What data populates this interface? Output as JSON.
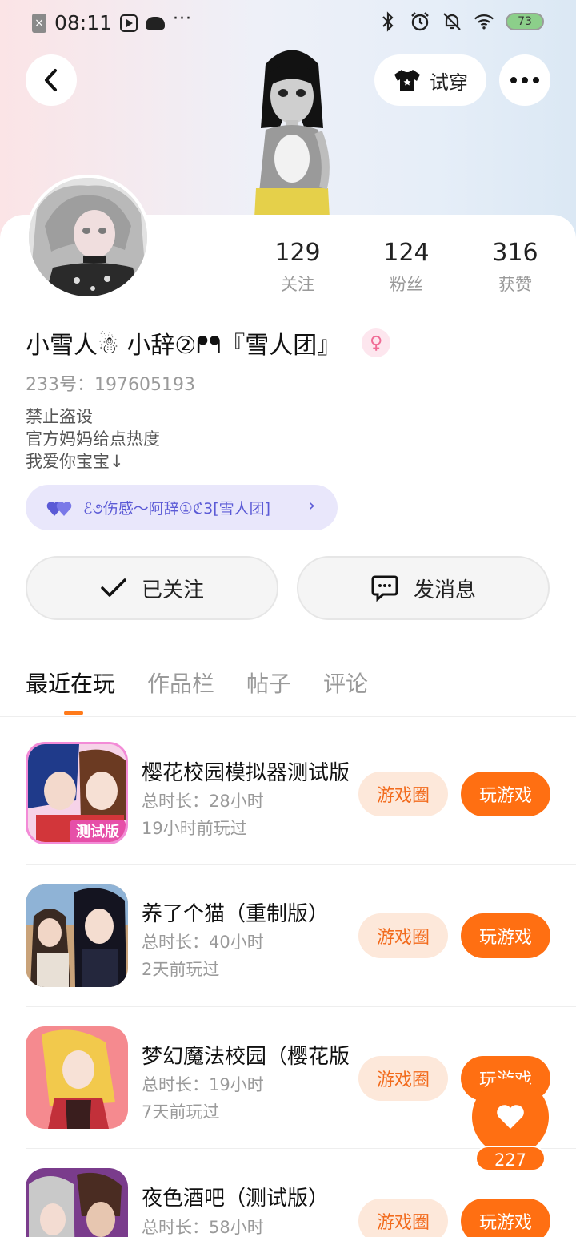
{
  "status_bar": {
    "time": "08:11",
    "battery": "73"
  },
  "header": {
    "tryon_label": "试穿"
  },
  "profile": {
    "nickname": "小雪人☃ 小辞②ᖰᖳ『雪人团』",
    "uid_text": "233号：197605193",
    "bio": [
      "禁止盗设",
      "官方妈妈给点热度",
      "我爱你宝宝↓"
    ],
    "group_chip": "ℰ૭伤感～阿辞①ℭ3[雪人团]",
    "stats": [
      {
        "value": "129",
        "label": "关注"
      },
      {
        "value": "124",
        "label": "粉丝"
      },
      {
        "value": "316",
        "label": "获赞"
      }
    ]
  },
  "actions": {
    "followed_label": "已关注",
    "message_label": "发消息"
  },
  "tabs": [
    "最近在玩",
    "作品栏",
    "帖子",
    "评论"
  ],
  "games": [
    {
      "title": "樱花校园模拟器测试版",
      "duration": "总时长：28小时",
      "last_played": "19小时前玩过",
      "circle_label": "游戏圈",
      "play_label": "玩游戏",
      "icon_caption": "测试版"
    },
    {
      "title": "养了个猫（重制版）",
      "duration": "总时长：40小时",
      "last_played": "2天前玩过",
      "circle_label": "游戏圈",
      "play_label": "玩游戏"
    },
    {
      "title": "梦幻魔法校园（樱花版）",
      "duration": "总时长：19小时",
      "last_played": "7天前玩过",
      "circle_label": "游戏圈",
      "play_label": "玩游戏"
    },
    {
      "title": "夜色酒吧（测试版）",
      "duration": "总时长：58小时",
      "last_played": "",
      "circle_label": "游戏圈",
      "play_label": "玩游戏"
    }
  ],
  "fab": {
    "like_count": "227"
  }
}
